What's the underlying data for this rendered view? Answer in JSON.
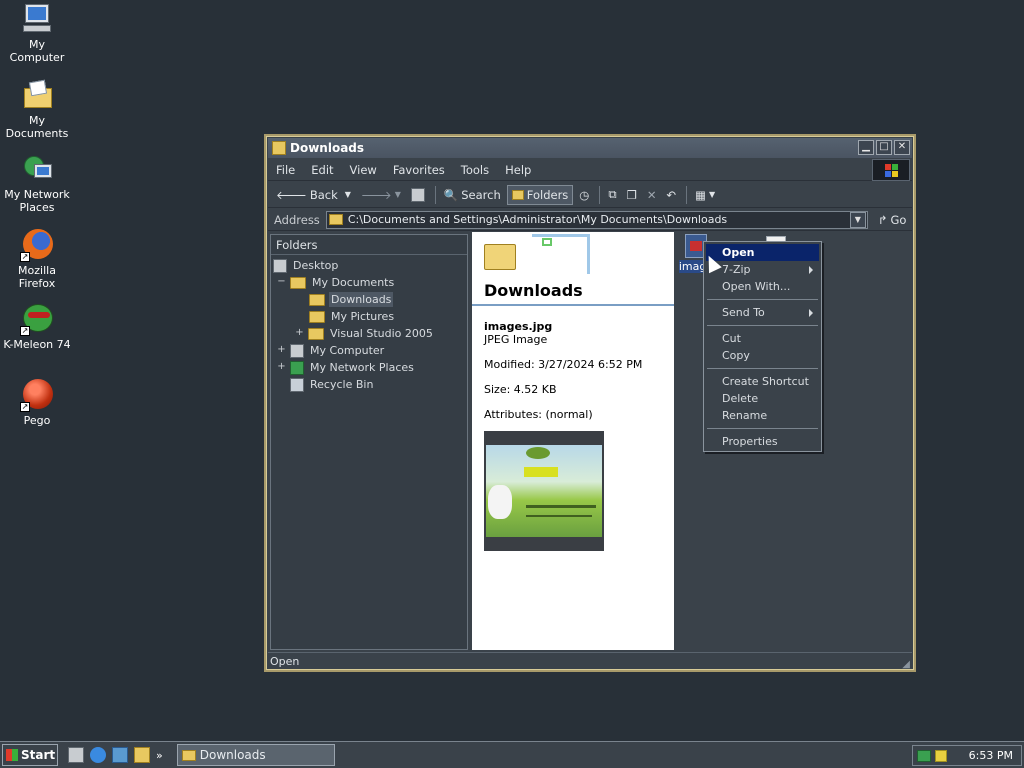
{
  "desktop": {
    "icons": [
      {
        "label": "My Computer"
      },
      {
        "label": "My Documents"
      },
      {
        "label": "My Network Places"
      },
      {
        "label": "Mozilla Firefox"
      },
      {
        "label": "K-Meleon 74"
      },
      {
        "label": "Pego"
      }
    ]
  },
  "window": {
    "title": "Downloads",
    "menu": [
      "File",
      "Edit",
      "View",
      "Favorites",
      "Tools",
      "Help"
    ],
    "toolbar": {
      "back": "Back",
      "search": "Search",
      "folders": "Folders"
    },
    "address": {
      "label": "Address",
      "value": "C:\\Documents and Settings\\Administrator\\My Documents\\Downloads",
      "go": "Go"
    },
    "folders_pane": {
      "header": "Folders",
      "tree": [
        {
          "label": "Desktop",
          "expander": ""
        },
        {
          "label": "My Documents",
          "expander": "−"
        },
        {
          "label": "Downloads",
          "expander": ""
        },
        {
          "label": "My Pictures",
          "expander": ""
        },
        {
          "label": "Visual Studio 2005",
          "expander": "+"
        },
        {
          "label": "My Computer",
          "expander": "+"
        },
        {
          "label": "My Network Places",
          "expander": "+"
        },
        {
          "label": "Recycle Bin",
          "expander": ""
        }
      ]
    },
    "details": {
      "folder_title": "Downloads",
      "file_name": "images.jpg",
      "file_type": "JPEG Image",
      "modified": "Modified: 3/27/2024 6:52 PM",
      "size": "Size: 4.52 KB",
      "attributes": "Attributes: (normal)"
    },
    "file": {
      "label": "image"
    },
    "status": "Open"
  },
  "context_menu": {
    "items": [
      {
        "label": "Open"
      },
      {
        "label": "7-Zip"
      },
      {
        "label": "Open With..."
      },
      {
        "label": "Send To"
      },
      {
        "label": "Cut"
      },
      {
        "label": "Copy"
      },
      {
        "label": "Create Shortcut"
      },
      {
        "label": "Delete"
      },
      {
        "label": "Rename"
      },
      {
        "label": "Properties"
      }
    ]
  },
  "taskbar": {
    "start": "Start",
    "more": "»",
    "task": "Downloads",
    "clock": "6:53 PM"
  },
  "colors": {
    "menu_highlight": "#0a246a",
    "window_border": "#a89a6a",
    "desktop": "#283038"
  }
}
